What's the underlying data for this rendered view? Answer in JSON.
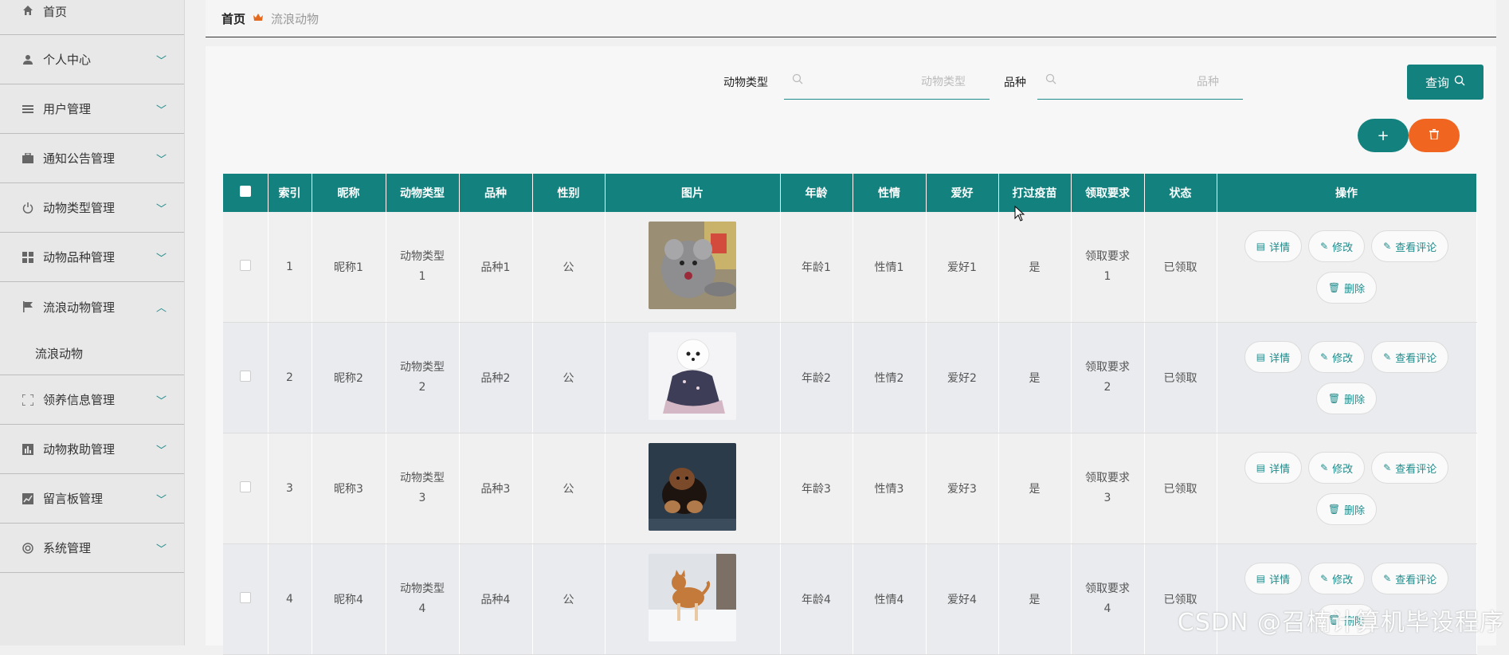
{
  "sidebar": {
    "items": [
      {
        "label": "首页",
        "icon": "home-icon"
      },
      {
        "label": "个人中心",
        "icon": "user-icon"
      },
      {
        "label": "用户管理",
        "icon": "list-icon"
      },
      {
        "label": "通知公告管理",
        "icon": "briefcase-icon"
      },
      {
        "label": "动物类型管理",
        "icon": "power-icon"
      },
      {
        "label": "动物品种管理",
        "icon": "grid-icon"
      },
      {
        "label": "流浪动物管理",
        "icon": "flag-icon"
      },
      {
        "label": "领养信息管理",
        "icon": "scan-icon"
      },
      {
        "label": "动物救助管理",
        "icon": "chart-bar-icon"
      },
      {
        "label": "留言板管理",
        "icon": "chart-line-icon"
      },
      {
        "label": "系统管理",
        "icon": "lifebuoy-icon"
      }
    ],
    "sub_item": "流浪动物"
  },
  "breadcrumb": {
    "home": "首页",
    "current": "流浪动物"
  },
  "search": {
    "type_label": "动物类型",
    "type_placeholder": "动物类型",
    "type_value": "",
    "breed_label": "品种",
    "breed_placeholder": "品种",
    "breed_value": "",
    "query_label": "查询"
  },
  "actions": {
    "add": "+",
    "delete_icon": "trash-icon"
  },
  "table": {
    "headers": [
      "索引",
      "昵称",
      "动物类型",
      "品种",
      "性别",
      "图片",
      "年龄",
      "性情",
      "爱好",
      "打过疫苗",
      "领取要求",
      "状态",
      "操作"
    ],
    "rows": [
      {
        "index": "1",
        "nickname": "昵称1",
        "type_a": "动物类型",
        "type_b": "1",
        "breed": "品种1",
        "sex": "公",
        "photo": "chinchilla",
        "age": "年龄1",
        "temper": "性情1",
        "hobby": "爱好1",
        "vaccinated": "是",
        "req_a": "领取要求",
        "req_b": "1",
        "status": "已领取"
      },
      {
        "index": "2",
        "nickname": "昵称2",
        "type_a": "动物类型",
        "type_b": "2",
        "breed": "品种2",
        "sex": "公",
        "photo": "white-dog",
        "age": "年龄2",
        "temper": "性情2",
        "hobby": "爱好2",
        "vaccinated": "是",
        "req_a": "领取要求",
        "req_b": "2",
        "status": "已领取"
      },
      {
        "index": "3",
        "nickname": "昵称3",
        "type_a": "动物类型",
        "type_b": "3",
        "breed": "品种3",
        "sex": "公",
        "photo": "puppy-dark",
        "age": "年龄3",
        "temper": "性情3",
        "hobby": "爱好3",
        "vaccinated": "是",
        "req_a": "领取要求",
        "req_b": "3",
        "status": "已领取"
      },
      {
        "index": "4",
        "nickname": "昵称4",
        "type_a": "动物类型",
        "type_b": "4",
        "breed": "品种4",
        "sex": "公",
        "photo": "shiba-snow",
        "age": "年龄4",
        "temper": "性情4",
        "hobby": "爱好4",
        "vaccinated": "是",
        "req_a": "领取要求",
        "req_b": "4",
        "status": "已领取"
      }
    ],
    "ops": {
      "detail": "详情",
      "edit": "修改",
      "comments": "查看评论",
      "delete": "删除"
    }
  },
  "watermark": "CSDN @召楠计算机毕设程序",
  "colors": {
    "primary": "#13827f",
    "danger": "#f0651f"
  }
}
